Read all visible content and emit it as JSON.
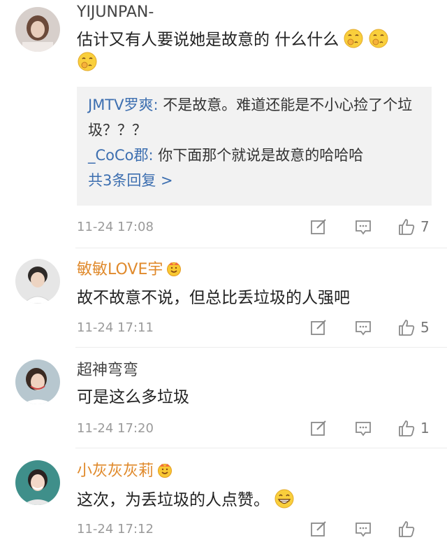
{
  "comments": [
    {
      "username": "YIJUNPAN-",
      "content": "估计又有人要说她是故意的 什么什么",
      "emojis": [
        "thinking-emoji",
        "thinking-emoji",
        "thinking-emoji"
      ],
      "replies": [
        {
          "name": "JMTV罗爽:",
          "text": " 不是故意。难道还能是不小心捡了个垃圾？？？"
        },
        {
          "name": "_CoCo郡:",
          "text": " 你下面那个就说是故意的哈哈哈"
        }
      ],
      "more_replies": "共3条回复 >",
      "time": "11-24 17:08",
      "likes": "7"
    },
    {
      "username": "敏敏LOVE宇",
      "badge": "crown-icon",
      "content": "故不故意不说，但总比丢垃圾的人强吧",
      "time": "11-24 17:11",
      "likes": "5"
    },
    {
      "username": "超神弯弯",
      "content": "可是这么多垃圾",
      "time": "11-24 17:20",
      "likes": "1"
    },
    {
      "username": "小灰灰灰莉",
      "badge": "crown-icon",
      "content": "这次，为丢垃圾的人点赞。",
      "emojis": [
        "grin-emoji"
      ],
      "time": "11-24 17:12"
    }
  ],
  "colors": {
    "reply_name": "#3d6fb0",
    "vip_name": "#e08a2c",
    "meta_gray": "#9a9a9a",
    "reply_bg": "#f2f2f2"
  },
  "icons": {
    "edit": "edit-icon",
    "comment": "comment-icon",
    "like": "thumbs-up-icon"
  }
}
